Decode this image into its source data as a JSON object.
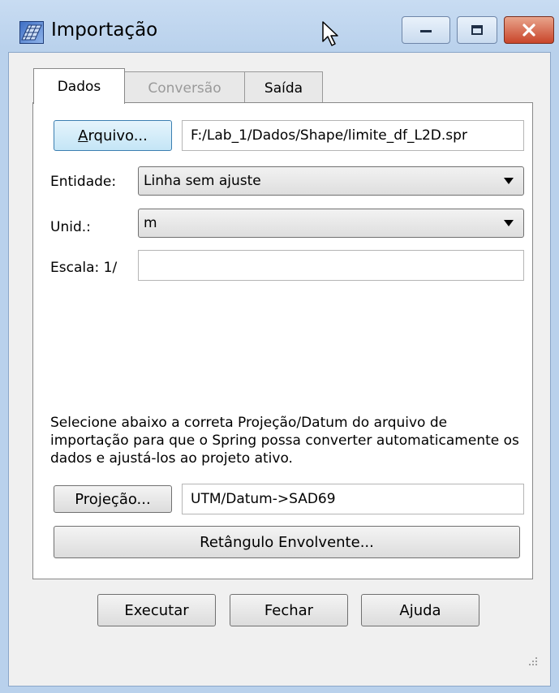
{
  "window": {
    "title": "Importação",
    "controls": {
      "minimize_icon": "minimize-icon",
      "maximize_icon": "maximize-icon",
      "close_icon": "close-icon"
    }
  },
  "tabs": [
    {
      "label": "Dados",
      "state": "active"
    },
    {
      "label": "Conversão",
      "state": "disabled"
    },
    {
      "label": "Saída",
      "state": "normal"
    }
  ],
  "file": {
    "button_label_mnemonic": "A",
    "button_label_rest": "rquivo...",
    "path": "F:/Lab_1/Dados/Shape/limite_df_L2D.spr"
  },
  "entidade": {
    "label": "Entidade:",
    "value": "Linha sem ajuste"
  },
  "unidade": {
    "label": "Unid.:",
    "value": "m"
  },
  "escala": {
    "label": "Escala: 1/",
    "value": ""
  },
  "info_text": "Selecione abaixo a correta Projeção/Datum do arquivo de importação para que o Spring possa converter automaticamente os dados e ajustá-los ao projeto ativo.",
  "projecao": {
    "button_label_pre": "Pro",
    "button_label_mnemonic": "j",
    "button_label_post": "eção...",
    "value": "UTM/Datum->SAD69"
  },
  "retangulo_button": "Retângulo Envolvente...",
  "footer": {
    "executar": "Executar",
    "fechar": "Fechar",
    "ajuda": "Ajuda"
  },
  "colors": {
    "frame": "#b9d1ec",
    "close_button": "#c9452a",
    "focused_button": "#c4e5f6"
  }
}
